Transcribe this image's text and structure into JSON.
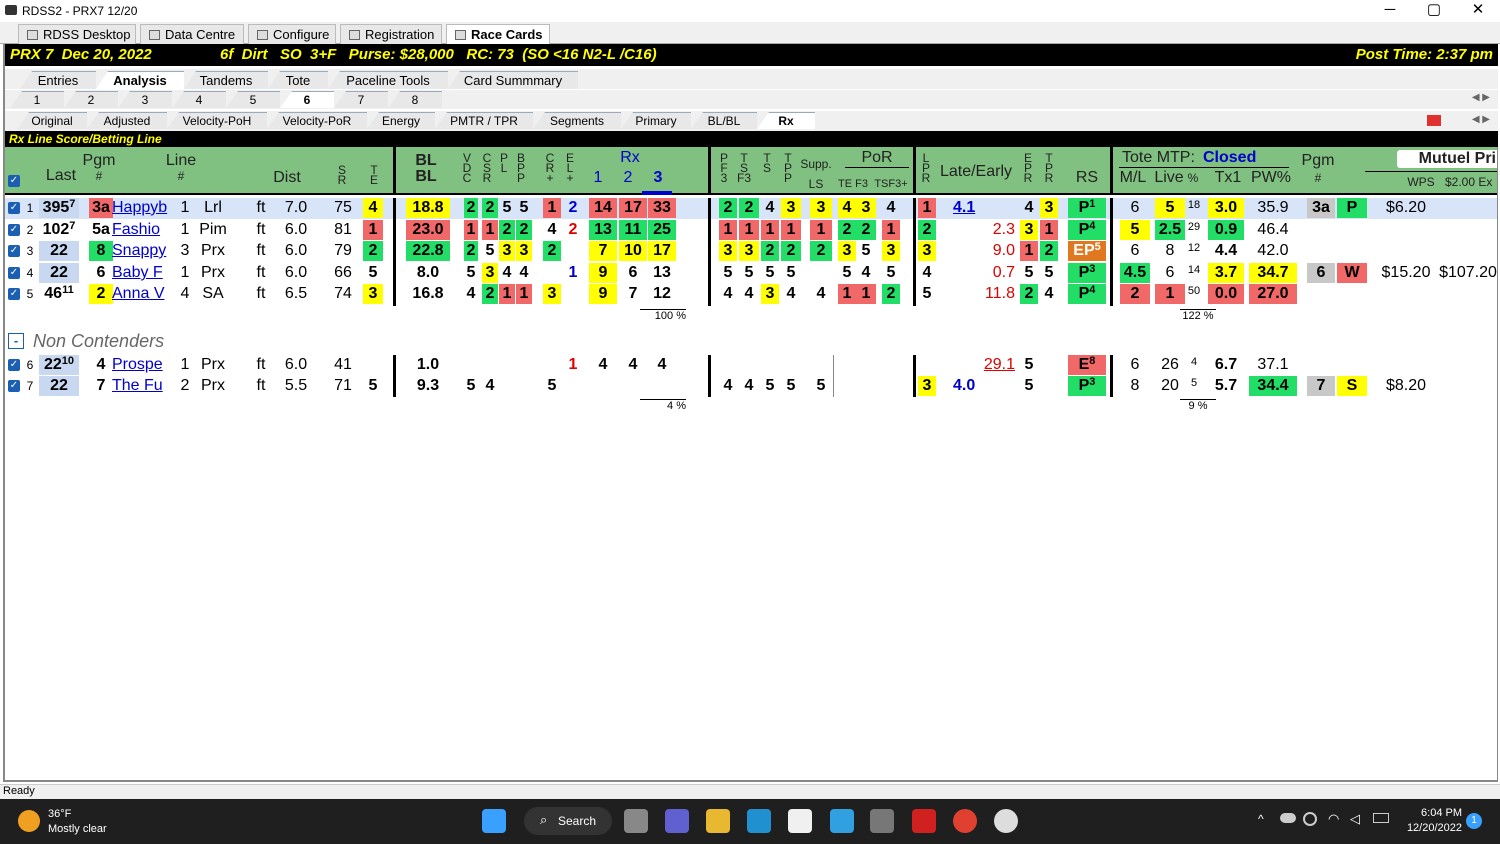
{
  "window": {
    "title": "RDSS2 - PRX7  12/20",
    "min": "─",
    "max": "▢",
    "close": "✕"
  },
  "tabs": [
    "RDSS Desktop",
    "Data Centre",
    "Configure",
    "Registration",
    "Race Cards"
  ],
  "race": {
    "left": "PRX 7  Dec 20, 2022",
    "info": "6f  Dirt   SO  3+F   Purse: $28,000   RC: 73  (SO <16 N2-L /C16)",
    "post": "Post Time: 2:37 pm"
  },
  "subtabs": [
    "Entries",
    "Analysis",
    "Tandems",
    "Tote",
    "Paceline Tools",
    "Card Summmary"
  ],
  "races": [
    "1",
    "2",
    "3",
    "4",
    "5",
    "6",
    "7",
    "8"
  ],
  "viewtabs": [
    "Original",
    "Adjusted",
    "Velocity-PoH",
    "Velocity-PoR",
    "Energy",
    "PMTR / TPR",
    "Segments",
    "Primary",
    "BL/BL",
    "Rx"
  ],
  "section": "Rx Line Score/Betting Line",
  "cols": {
    "pgm": "Pgm",
    "pgmnum": "#",
    "last": "Last",
    "line": "Line",
    "linenum": "#",
    "dist": "Dist",
    "sr": "S\nR",
    "te": "T\nE",
    "blbl": "BL\nBL",
    "vdc": "V\nD\nC",
    "csr": "C\nS\nR",
    "pl": "P\nL",
    "bpp": "B\nP\nP",
    "cr": "C\nR\n+",
    "el": "E\nL\n+",
    "rx": "Rx",
    "rx1": "1",
    "rx2": "2",
    "rx3": "3",
    "pf3": "P\nF\n3",
    "tsf3": "T\nS\nF3",
    "ts": "T\nS",
    "tpp": "T\nP\nP",
    "supp": "Supp.",
    "ls": "LS",
    "por": "PoR",
    "tef3": "TE F3",
    "tsf3p": "TSF3+",
    "lpr": "L\nP\nR",
    "late": "Late/Early",
    "epr": "E\nP\nR",
    "tpr": "T\nP\nR",
    "rs": "RS",
    "tote": "Tote MTP:",
    "closed": "Closed",
    "ml": "M/L",
    "live": "Live",
    "pct": "%",
    "tx1": "Tx1",
    "pw": "PW%",
    "pgm2": "Pgm",
    "pgm2n": "#",
    "mutuel": "Mutuel Pri",
    "wps": "WPS",
    "ex": "$2.00 Ex"
  },
  "noncont": "Non Contenders",
  "noncont_btn": "-",
  "pcts": {
    "rx": "100 %",
    "tote": "122 %",
    "rx_nc": "4 %",
    "tote_nc": "9 %"
  },
  "rows": [
    {
      "n": "1",
      "last": "395",
      "lsup": "7",
      "pgm": "3a",
      "name": "Happyb",
      "ln": "1",
      "trk": "Lrl",
      "sf": "ft",
      "dist": "7.0",
      "sr": "75",
      "te": "4",
      "bl": "18.8",
      "v": "2",
      "cs": "2",
      "pl": "5",
      "bp": "5",
      "cr": "1",
      "el": "2",
      "r1": "14",
      "r2": "17",
      "r3": "33",
      "pf": "2",
      "tsf": "2",
      "ts": "4",
      "tp": "3",
      "ls": "3",
      "te3": "4",
      "ts3": "3",
      "tsp": "4",
      "lpr": "1",
      "late": "4.1",
      "ep": "4",
      "tpr": "3",
      "rs": "P",
      "rsup": "1",
      "ml": "6",
      "live": "5",
      "pc": "18",
      "tx": "3.0",
      "pw": "35.9",
      "p2": "3a",
      "fin": "P",
      "pay": "$6.20",
      "ex": ""
    },
    {
      "n": "2",
      "last": "102",
      "lsup": "7",
      "pgm": "5a",
      "name": "Fashio",
      "ln": "1",
      "trk": "Pim",
      "sf": "ft",
      "dist": "6.0",
      "sr": "81",
      "te": "1",
      "bl": "23.0",
      "v": "1",
      "cs": "1",
      "pl": "2",
      "bp": "2",
      "cr": "4",
      "el": "2",
      "r1": "13",
      "r2": "11",
      "r3": "25",
      "pf": "1",
      "tsf": "1",
      "ts": "1",
      "tp": "1",
      "ls": "1",
      "te3": "2",
      "ts3": "2",
      "tsp": "1",
      "lpr": "2",
      "late": "2.3",
      "ep": "3",
      "tpr": "1",
      "rs": "P",
      "rsup": "4",
      "ml": "5",
      "live": "2.5",
      "pc": "29",
      "tx": "0.9",
      "pw": "46.4",
      "p2": "",
      "fin": "",
      "pay": "",
      "ex": ""
    },
    {
      "n": "3",
      "last": "22",
      "lsup": "",
      "pgm": "8",
      "name": "Snappy",
      "ln": "3",
      "trk": "Prx",
      "sf": "ft",
      "dist": "6.0",
      "sr": "79",
      "te": "2",
      "bl": "22.8",
      "v": "2",
      "cs": "5",
      "pl": "3",
      "bp": "3",
      "cr": "2",
      "el": "",
      "r1": "7",
      "r2": "10",
      "r3": "17",
      "pf": "3",
      "tsf": "3",
      "ts": "2",
      "tp": "2",
      "ls": "2",
      "te3": "3",
      "ts3": "5",
      "tsp": "3",
      "lpr": "3",
      "late": "9.0",
      "ep": "1",
      "tpr": "2",
      "rs": "EP",
      "rsup": "5",
      "ml": "6",
      "live": "8",
      "pc": "12",
      "tx": "4.4",
      "pw": "42.0",
      "p2": "",
      "fin": "",
      "pay": "",
      "ex": ""
    },
    {
      "n": "4",
      "last": "22",
      "lsup": "",
      "pgm": "6",
      "name": "Baby F",
      "ln": "1",
      "trk": "Prx",
      "sf": "ft",
      "dist": "6.0",
      "sr": "66",
      "te": "5",
      "bl": "8.0",
      "v": "5",
      "cs": "3",
      "pl": "4",
      "bp": "4",
      "cr": "",
      "el": "1",
      "r1": "9",
      "r2": "6",
      "r3": "13",
      "pf": "5",
      "tsf": "5",
      "ts": "5",
      "tp": "5",
      "ls": "",
      "te3": "5",
      "ts3": "4",
      "tsp": "5",
      "lpr": "4",
      "late": "0.7",
      "ep": "5",
      "tpr": "5",
      "rs": "P",
      "rsup": "3",
      "ml": "4.5",
      "live": "6",
      "pc": "14",
      "tx": "3.7",
      "pw": "34.7",
      "p2": "6",
      "fin": "W",
      "pay": "$15.20",
      "ex": "$107.20"
    },
    {
      "n": "5",
      "last": "46",
      "lsup": "11",
      "pgm": "2",
      "name": "Anna V",
      "ln": "4",
      "trk": "SA",
      "sf": "ft",
      "dist": "6.5",
      "sr": "74",
      "te": "3",
      "bl": "16.8",
      "v": "4",
      "cs": "2",
      "pl": "1",
      "bp": "1",
      "cr": "3",
      "el": "",
      "r1": "9",
      "r2": "7",
      "r3": "12",
      "pf": "4",
      "tsf": "4",
      "ts": "3",
      "tp": "4",
      "ls": "4",
      "te3": "1",
      "ts3": "1",
      "tsp": "2",
      "lpr": "5",
      "late": "11.8",
      "ep": "2",
      "tpr": "4",
      "rs": "P",
      "rsup": "4",
      "ml": "2",
      "live": "1",
      "pc": "50",
      "tx": "0.0",
      "pw": "27.0",
      "p2": "",
      "fin": "",
      "pay": "",
      "ex": ""
    },
    {
      "n": "6",
      "last": "22",
      "lsup": "10",
      "pgm": "4",
      "name": "Prospe",
      "ln": "1",
      "trk": "Prx",
      "sf": "ft",
      "dist": "6.0",
      "sr": "41",
      "te": "",
      "bl": "1.0",
      "v": "",
      "cs": "",
      "pl": "",
      "bp": "",
      "cr": "",
      "el": "1",
      "r1": "4",
      "r2": "4",
      "r3": "4",
      "pf": "",
      "tsf": "",
      "ts": "",
      "tp": "",
      "ls": "",
      "te3": "",
      "ts3": "",
      "tsp": "",
      "lpr": "",
      "late": "29.1",
      "ep": "5",
      "tpr": "",
      "rs": "E",
      "rsup": "8",
      "ml": "6",
      "live": "26",
      "pc": "4",
      "tx": "6.7",
      "pw": "37.1",
      "p2": "",
      "fin": "",
      "pay": "",
      "ex": ""
    },
    {
      "n": "7",
      "last": "22",
      "lsup": "",
      "pgm": "7",
      "name": "The Fu",
      "ln": "2",
      "trk": "Prx",
      "sf": "ft",
      "dist": "5.5",
      "sr": "71",
      "te": "5",
      "bl": "9.3",
      "v": "5",
      "cs": "4",
      "pl": "",
      "bp": "",
      "cr": "5",
      "el": "",
      "r1": "",
      "r2": "",
      "r3": "",
      "pf": "4",
      "tsf": "4",
      "ts": "5",
      "tp": "5",
      "ls": "5",
      "te3": "",
      "ts3": "",
      "tsp": "",
      "lpr": "3",
      "late": "4.0",
      "ep": "5",
      "tpr": "",
      "rs": "P",
      "rsup": "3",
      "ml": "8",
      "live": "20",
      "pc": "5",
      "tx": "5.7",
      "pw": "34.4",
      "p2": "7",
      "fin": "S",
      "pay": "$8.20",
      "ex": ""
    }
  ],
  "status": "Ready",
  "taskbar": {
    "temp": "36°F",
    "weather": "Mostly clear",
    "search": "Search",
    "time": "6:04 PM",
    "date": "12/20/2022",
    "notif": "1"
  }
}
